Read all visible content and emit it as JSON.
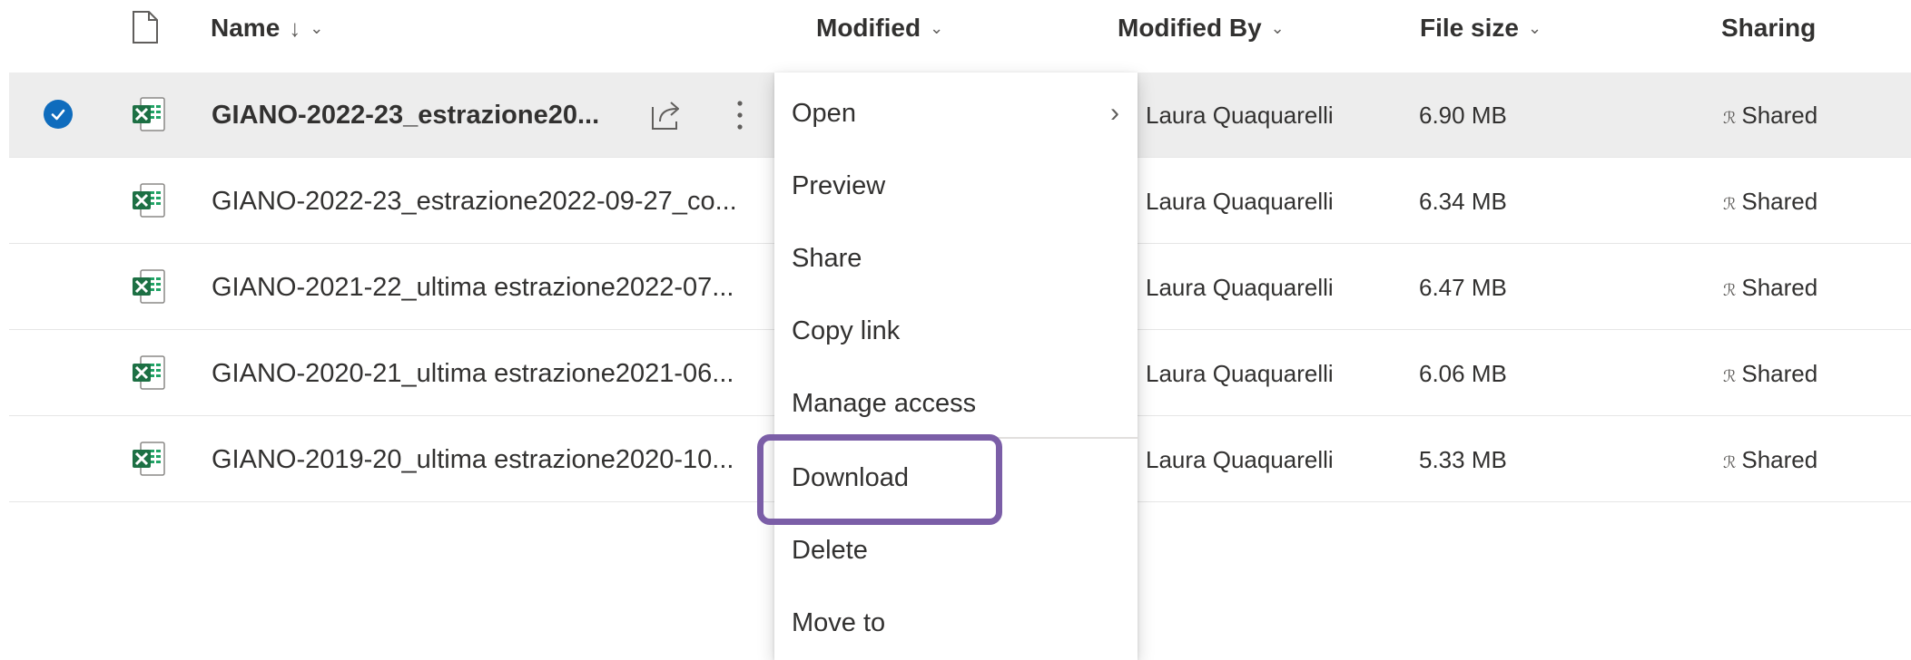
{
  "header": {
    "name_label": "Name",
    "name_sort_glyph": "↓",
    "modified_label": "Modified",
    "modified_by_label": "Modified By",
    "file_size_label": "File size",
    "sharing_label": "Sharing",
    "column_chevron": "⌄"
  },
  "files": [
    {
      "name": "GIANO-2022-23_estrazione20...",
      "modified_by": "Laura Quaquarelli",
      "file_size": "6.90 MB",
      "sharing": "Shared"
    },
    {
      "name": "GIANO-2022-23_estrazione2022-09-27_co...",
      "modified_by": "Laura Quaquarelli",
      "file_size": "6.34 MB",
      "sharing": "Shared"
    },
    {
      "name": "GIANO-2021-22_ultima estrazione2022-07...",
      "modified_by": "Laura Quaquarelli",
      "file_size": "6.47 MB",
      "sharing": "Shared"
    },
    {
      "name": "GIANO-2020-21_ultima estrazione2021-06...",
      "modified_by": "Laura Quaquarelli",
      "file_size": "6.06 MB",
      "sharing": "Shared"
    },
    {
      "name": "GIANO-2019-20_ultima estrazione2020-10...",
      "modified_by": "Laura Quaquarelli",
      "file_size": "5.33 MB",
      "sharing": "Shared"
    }
  ],
  "context_menu": {
    "items": [
      "Open",
      "Preview",
      "Share",
      "Copy link",
      "Manage access",
      "Download",
      "Delete",
      "Move to"
    ],
    "submenu_glyph": "›"
  },
  "icons": {
    "header_file": "document-icon",
    "row_file": "excel-file-icon",
    "selected": "checkmark-circle-icon",
    "share": "share-icon",
    "more": "more-vertical-icon",
    "sharing": "people-icon"
  },
  "colors": {
    "selected_row_bg": "#ededed",
    "check_blue": "#0f6cbd",
    "excel_green": "#1d7044",
    "highlight_border": "#7b5ea7"
  }
}
